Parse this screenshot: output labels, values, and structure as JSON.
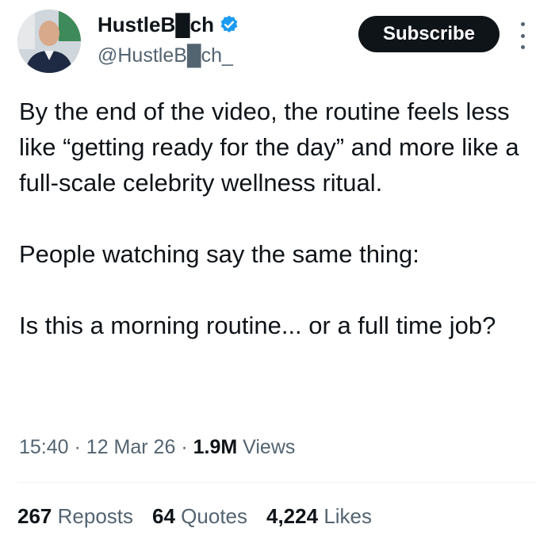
{
  "author": {
    "display_name": "HustleB█ch",
    "handle": "@HustleB█ch_",
    "verified_icon": "verified-badge-icon",
    "accent_color": "#1d9bf0"
  },
  "actions": {
    "subscribe_label": "Subscribe",
    "more_icon": "more-options-icon"
  },
  "tweet": {
    "paragraphs": [
      "By the end of the video, the routine feels less like “getting ready for the day” and more like a full-scale celebrity wellness ritual.",
      "People watching say the same thing:",
      "Is this a morning routine... or a full time job?"
    ],
    "time": "15:40",
    "date": "12 Mar 26",
    "views_count": "1.9M",
    "views_label": "Views"
  },
  "stats": {
    "reposts_count": "267",
    "reposts_label": "Reposts",
    "quotes_count": "64",
    "quotes_label": "Quotes",
    "likes_count": "4,224",
    "likes_label": "Likes"
  }
}
